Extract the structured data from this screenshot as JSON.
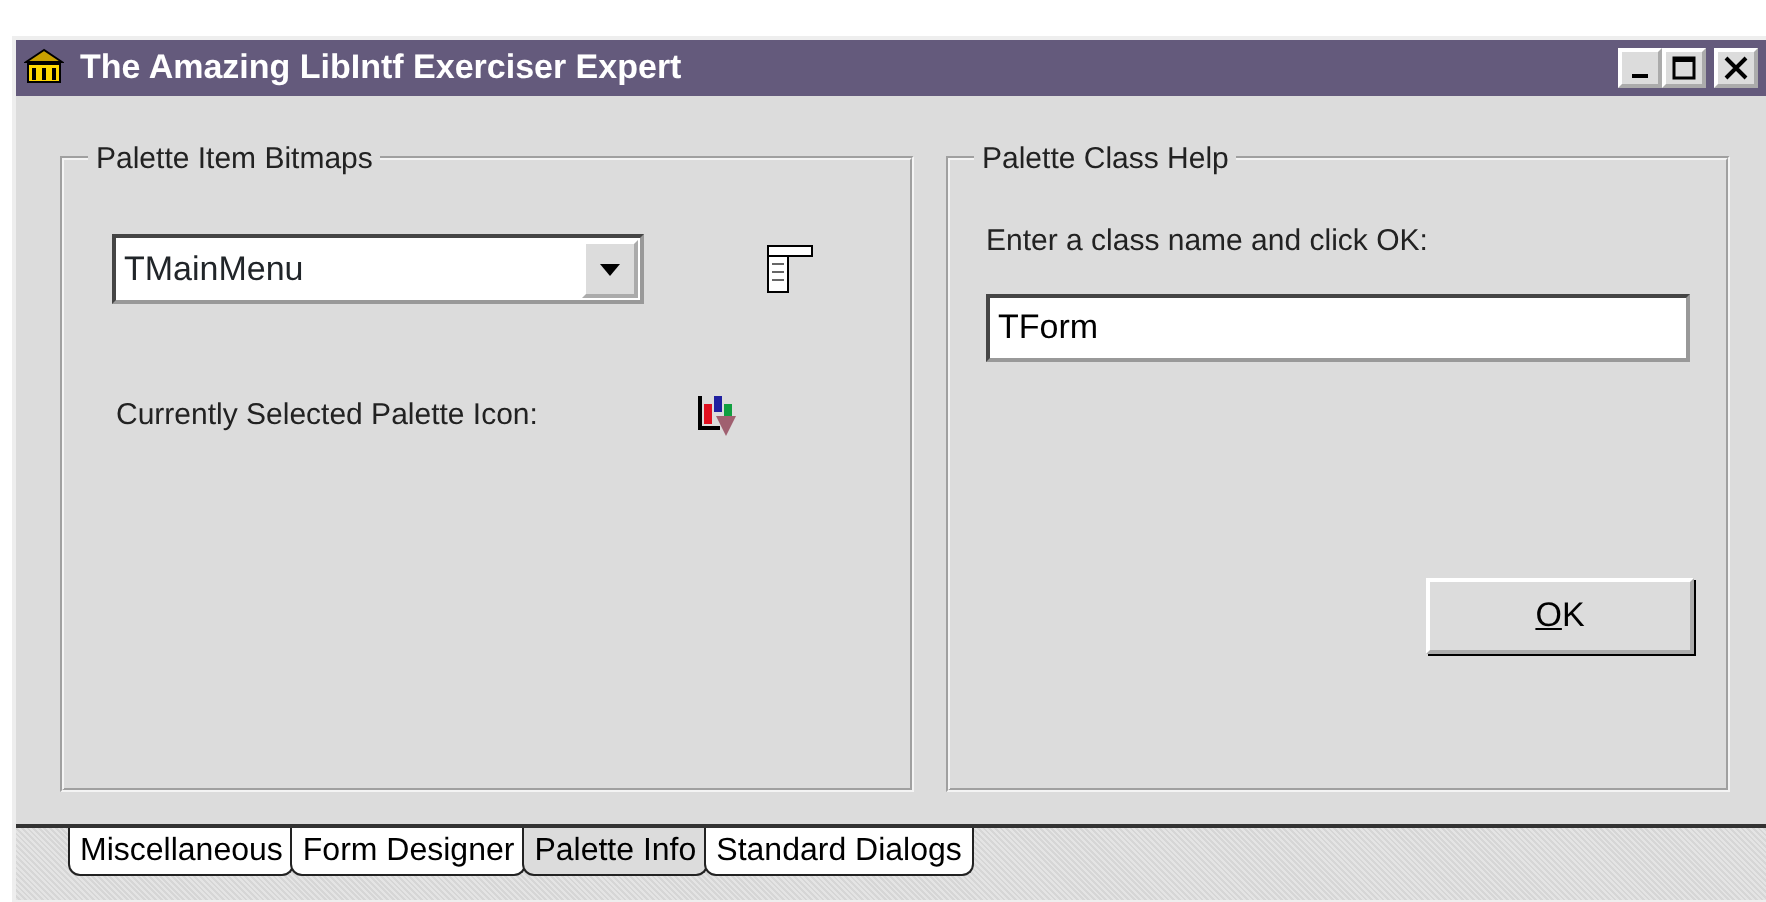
{
  "window": {
    "title": "The Amazing LibIntf Exerciser Expert"
  },
  "left_group": {
    "title": "Palette Item Bitmaps",
    "dropdown": {
      "value": "TMainMenu"
    },
    "selected_icon_label": "Currently Selected Palette Icon:"
  },
  "right_group": {
    "title": "Palette Class Help",
    "prompt": "Enter a class name and click OK:",
    "class_field": {
      "value": "TForm"
    },
    "ok_button": "OK"
  },
  "tabs": [
    {
      "label": "Miscellaneous",
      "selected": false
    },
    {
      "label": "Form Designer",
      "selected": false
    },
    {
      "label": "Palette Info",
      "selected": true
    },
    {
      "label": "Standard Dialogs",
      "selected": false
    }
  ]
}
